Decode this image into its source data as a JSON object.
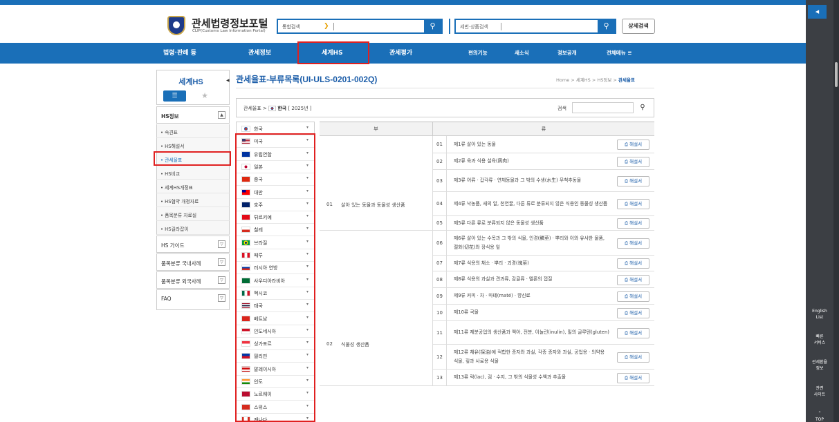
{
  "header": {
    "logo_title": "관세법령정보포털",
    "logo_subtitle": "CLIP(Customs Law Information Portal)",
    "search_select": "통합검색",
    "search_icon": "search-icon",
    "search2_placeholder": "세번·상품검색",
    "detail_search": "상세검색"
  },
  "nav": {
    "items": [
      "법령·판례 등",
      "관세정보",
      "세계HS",
      "관세평가",
      "편의기능",
      "새소식",
      "정보공개",
      "전체메뉴 ≡"
    ],
    "active": "세계HS"
  },
  "sidebar": {
    "title": "세계HS",
    "section_hs": "HS정보",
    "sub_items": [
      "속견표",
      "HS해설서",
      "관세율표",
      "HS비교",
      "세계HS개정표",
      "HS협약 개정자료",
      "품목분류 자료실",
      "HS길라잡이"
    ],
    "active_sub": "관세율표",
    "sections": [
      "HS 가이드",
      "품목분류 국내사례",
      "품목분류 외국사례",
      "FAQ"
    ]
  },
  "content": {
    "title": "관세율표-부류목록(UI-ULS-0201-002Q)",
    "breadcrumb": [
      "Home",
      "세계HS",
      "HS정보",
      "관세율표"
    ],
    "filter_prefix": "관세율표 > ",
    "filter_country": "한국",
    "filter_year": "[ 2025년 ]",
    "search_label": "검색"
  },
  "countries": [
    {
      "name": "한국",
      "flag": "kr"
    },
    {
      "name": "미국",
      "flag": "us"
    },
    {
      "name": "유럽연합",
      "flag": "eu"
    },
    {
      "name": "일본",
      "flag": "jp"
    },
    {
      "name": "중국",
      "flag": "cn"
    },
    {
      "name": "대만",
      "flag": "tw"
    },
    {
      "name": "호주",
      "flag": "au"
    },
    {
      "name": "튀르키예",
      "flag": "tr"
    },
    {
      "name": "칠레",
      "flag": "cl"
    },
    {
      "name": "브라질",
      "flag": "br"
    },
    {
      "name": "페루",
      "flag": "pe"
    },
    {
      "name": "러시아 연방",
      "flag": "ru"
    },
    {
      "name": "사우디아라비아",
      "flag": "sa"
    },
    {
      "name": "멕시코",
      "flag": "mx"
    },
    {
      "name": "태국",
      "flag": "th"
    },
    {
      "name": "베트남",
      "flag": "vn"
    },
    {
      "name": "인도네시아",
      "flag": "id"
    },
    {
      "name": "싱가포르",
      "flag": "sg"
    },
    {
      "name": "필리핀",
      "flag": "ph"
    },
    {
      "name": "말레이시아",
      "flag": "my"
    },
    {
      "name": "인도",
      "flag": "in"
    },
    {
      "name": "노르웨이",
      "flag": "no"
    },
    {
      "name": "스위스",
      "flag": "ch"
    },
    {
      "name": "캐나다",
      "flag": "ca"
    }
  ],
  "table": {
    "header_bu": "부",
    "header_ryu": "류",
    "explain_label": "해설서",
    "sections": [
      {
        "num": "01",
        "name": "살아 있는 동물과 동물성 생산품"
      },
      {
        "num": "02",
        "name": "식물성 생산품"
      }
    ],
    "rows": [
      {
        "num": "01",
        "text": "제1류 살아 있는 동물"
      },
      {
        "num": "02",
        "text": "제2류 육과 식용 설육(屑肉)"
      },
      {
        "num": "03",
        "text": "제3류 어류ㆍ갑각류ㆍ연체동물과 그 밖의 수생(水生) 무척추동물"
      },
      {
        "num": "04",
        "text": "제4류 낙농품, 새의 알, 천연꿀, 다른 류로 분류되지 않은 식용인 동물성 생산품"
      },
      {
        "num": "05",
        "text": "제5류 다른 류로 분류되지 않은 동물성 생산품"
      },
      {
        "num": "06",
        "text": "제6류 살아 있는 수목과 그 밖의 식물, 인경(鱗莖)ㆍ뿌리와 이와 유사한 물품, 절화(切花)와 장식용 잎"
      },
      {
        "num": "07",
        "text": "제7류 식용의 채소ㆍ뿌리ㆍ괴경(塊莖)"
      },
      {
        "num": "08",
        "text": "제8류 식용의 과실과 견과류, 감귤류ㆍ멜론의 껍질"
      },
      {
        "num": "09",
        "text": "제9류 커피ㆍ차ㆍ마테(maté)ㆍ향신료"
      },
      {
        "num": "10",
        "text": "제10류 곡물"
      },
      {
        "num": "11",
        "text": "제11류 제분공업의 생산품과 맥아, 전분, 이눌린(inulin), 밀의 글루텐(gluten)"
      },
      {
        "num": "12",
        "text": "제12류 채유(採油)에 적합한 종자와 과실, 각종 종자와 과실, 공업용ㆍ의약용 식물, 짚과 사료용 식물"
      },
      {
        "num": "13",
        "text": "제13류 락(lac), 검ㆍ수지, 그 밖의 식물성 수액과 추출물"
      }
    ]
  },
  "right_rail": {
    "items": [
      "English\nList",
      "빠른\n서비스",
      "관세환율\n정보",
      "관련\n사이트",
      "TOP"
    ]
  },
  "colors": {
    "primary": "#1a6fb8",
    "highlight": "#e02020",
    "rail": "#3c3f44"
  }
}
